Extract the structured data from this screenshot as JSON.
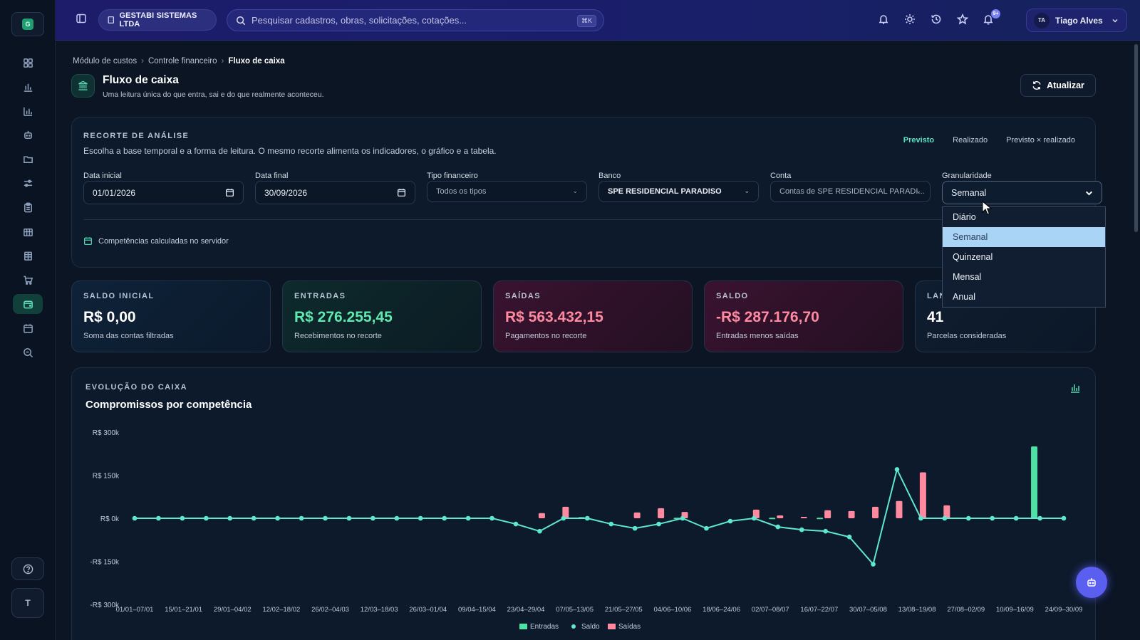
{
  "topbar": {
    "company": "GESTABI SISTEMAS LTDA",
    "search_placeholder": "Pesquisar cadastros, obras, solicitações, cotações...",
    "search_shortcut": "⌘K",
    "notification_count": "9+",
    "user_initials": "TA",
    "user_name": "Tiago Alves"
  },
  "sidebar": {
    "logo_letter": "G",
    "items": [
      "dashboard-icon",
      "chart-bar-icon",
      "chart-column-icon",
      "robot-icon",
      "folder-icon",
      "sliders-icon",
      "clipboard-icon",
      "building-icon",
      "building-alt-icon",
      "cart-icon",
      "wallet-icon",
      "calendar-icon",
      "search-icon"
    ],
    "active_index": 10,
    "bottom_avatar": "T"
  },
  "breadcrumb": [
    "Módulo de custos",
    "Controle financeiro",
    "Fluxo de caixa"
  ],
  "page": {
    "title": "Fluxo de caixa",
    "subtitle": "Uma leitura única do que entra, sai e do que realmente aconteceu.",
    "refresh_label": "Atualizar"
  },
  "filters": {
    "label": "RECORTE DE ANÁLISE",
    "description": "Escolha a base temporal e a forma de leitura. O mesmo recorte alimenta os indicadores, o gráfico e a tabela.",
    "modes": [
      "Previsto",
      "Realizado",
      "Previsto × realizado"
    ],
    "active_mode": "Previsto",
    "data_inicial_label": "Data inicial",
    "data_inicial": "01/01/2026",
    "data_final_label": "Data final",
    "data_final": "30/09/2026",
    "tipo_label": "Tipo financeiro",
    "tipo_value": "Todos os tipos",
    "banco_label": "Banco",
    "banco_value": "SPE RESIDENCIAL PARADISO",
    "conta_label": "Conta",
    "conta_value": "Contas de SPE RESIDENCIAL PARADI...",
    "granularidade_label": "Granularidade",
    "granularidade_value": "Semanal",
    "granularidade_options": [
      "Diário",
      "Semanal",
      "Quinzenal",
      "Mensal",
      "Anual"
    ],
    "server_note": "Competências calculadas no servidor"
  },
  "kpis": [
    {
      "label": "SALDO INICIAL",
      "value": "R$ 0,00",
      "sub": "Soma das contas filtradas",
      "color": "#ffffff"
    },
    {
      "label": "ENTRADAS",
      "value": "R$ 276.255,45",
      "sub": "Recebimentos no recorte",
      "color": "#5fe8b0"
    },
    {
      "label": "SAÍDAS",
      "value": "R$ 563.432,15",
      "sub": "Pagamentos no recorte",
      "color": "#ff8aa0"
    },
    {
      "label": "SALDO",
      "value": "-R$ 287.176,70",
      "sub": "Entradas menos saídas",
      "color": "#ff8aa0"
    },
    {
      "label": "LAN",
      "value": "41",
      "sub": "Parcelas consideradas",
      "color": "#ffffff"
    }
  ],
  "chart_section": {
    "label": "EVOLUÇÃO DO CAIXA",
    "title": "Compromissos por competência"
  },
  "chart_data": {
    "type": "bar",
    "ylabels": [
      "R$ 300k",
      "R$ 150k",
      "R$ 0k",
      "-R$ 150k",
      "-R$ 300k"
    ],
    "ylim": [
      -300000,
      300000
    ],
    "xlabels": [
      "01/01–07/01",
      "15/01–21/01",
      "29/01–04/02",
      "12/02–18/02",
      "26/02–04/03",
      "12/03–18/03",
      "26/03–01/04",
      "09/04–15/04",
      "23/04–29/04",
      "07/05–13/05",
      "21/05–27/05",
      "04/06–10/06",
      "18/06–24/06",
      "02/07–08/07",
      "16/07–22/07",
      "30/07–05/08",
      "13/08–19/08",
      "27/08–02/09",
      "10/09–16/09",
      "24/09–30/09"
    ],
    "series": [
      {
        "name": "Entradas",
        "color": "#4fe0a5",
        "values": [
          0,
          0,
          0,
          0,
          0,
          0,
          0,
          0,
          0,
          0,
          0,
          0,
          0,
          0,
          0,
          0,
          0,
          0,
          0,
          0,
          0,
          0,
          0,
          4000,
          0,
          0,
          0,
          2000,
          0,
          0,
          0,
          0,
          0,
          2000,
          0,
          0,
          0,
          0,
          0,
          0,
          0,
          0,
          3000,
          0,
          0,
          2000,
          0,
          0,
          0,
          0,
          0,
          0,
          0,
          0,
          0,
          0,
          0,
          0,
          0,
          0,
          0,
          0,
          2000,
          0,
          0,
          0,
          0,
          0,
          0,
          0,
          0,
          0,
          0,
          250000,
          0,
          0,
          0,
          0,
          0,
          0,
          0,
          0,
          0,
          0,
          0,
          0
        ]
      },
      {
        "name": "Saídas",
        "color": "#ff8aa0",
        "values": [
          0,
          0,
          0,
          0,
          0,
          0,
          0,
          0,
          0,
          0,
          0,
          0,
          0,
          0,
          0,
          0,
          0,
          0,
          0,
          0,
          0,
          0,
          0,
          0,
          0,
          0,
          0,
          0,
          0,
          0,
          0,
          0,
          0,
          0,
          0,
          0,
          0,
          0,
          0,
          0,
          0,
          0,
          0,
          0,
          0,
          0,
          0,
          0,
          0,
          0,
          0,
          0,
          0,
          0,
          0,
          0,
          0,
          0,
          0,
          0,
          0,
          0,
          0,
          0,
          0,
          0,
          0,
          0,
          0,
          0,
          0,
          0,
          0,
          0,
          0,
          0,
          0,
          0,
          0,
          0,
          0,
          0,
          0,
          0,
          0,
          0,
          0,
          0
        ]
      },
      {
        "name": "Saldo",
        "color": "#5fe8d0",
        "values": [
          0,
          0,
          0,
          0,
          0,
          0,
          0,
          0,
          0,
          0,
          0,
          0,
          0,
          0,
          0,
          0,
          0,
          -20000,
          -45000,
          0,
          0,
          0,
          0,
          -20000,
          -35000,
          -20000,
          0,
          0,
          -40000,
          -35000,
          -30000,
          -10000,
          0,
          -20000,
          -30000,
          -48000,
          -65000,
          -160000,
          170000,
          0,
          0,
          0,
          0,
          0,
          0
        ]
      }
    ],
    "weekly_entradas": [
      0,
      0,
      0,
      0,
      0,
      0,
      0,
      0,
      0,
      0,
      0,
      0,
      0,
      0,
      0,
      0,
      0,
      0,
      0,
      4000,
      0,
      0,
      0,
      2000,
      0,
      0,
      0,
      2000,
      0,
      2000,
      0,
      0,
      0,
      0,
      0,
      0,
      0,
      0,
      250000,
      0,
      0,
      0,
      0,
      0,
      0,
      0
    ],
    "weekly_saidas": [
      0,
      0,
      0,
      0,
      0,
      0,
      0,
      0,
      0,
      0,
      0,
      0,
      0,
      0,
      0,
      0,
      0,
      18000,
      40000,
      0,
      0,
      20000,
      35000,
      22000,
      0,
      0,
      30000,
      10000,
      5000,
      28000,
      25000,
      40000,
      60000,
      160000,
      45000,
      0,
      0,
      0,
      0,
      0
    ],
    "weekly_saldo": [
      0,
      0,
      0,
      0,
      0,
      0,
      0,
      0,
      0,
      0,
      0,
      0,
      0,
      0,
      0,
      0,
      -20000,
      -45000,
      0,
      0,
      -20000,
      -35000,
      -20000,
      0,
      -35000,
      -10000,
      0,
      -30000,
      -40000,
      -45000,
      -65000,
      -160000,
      170000,
      0,
      0,
      0,
      0,
      0,
      0,
      0
    ],
    "legend": [
      "Entradas",
      "Saldo",
      "Saídas"
    ]
  }
}
